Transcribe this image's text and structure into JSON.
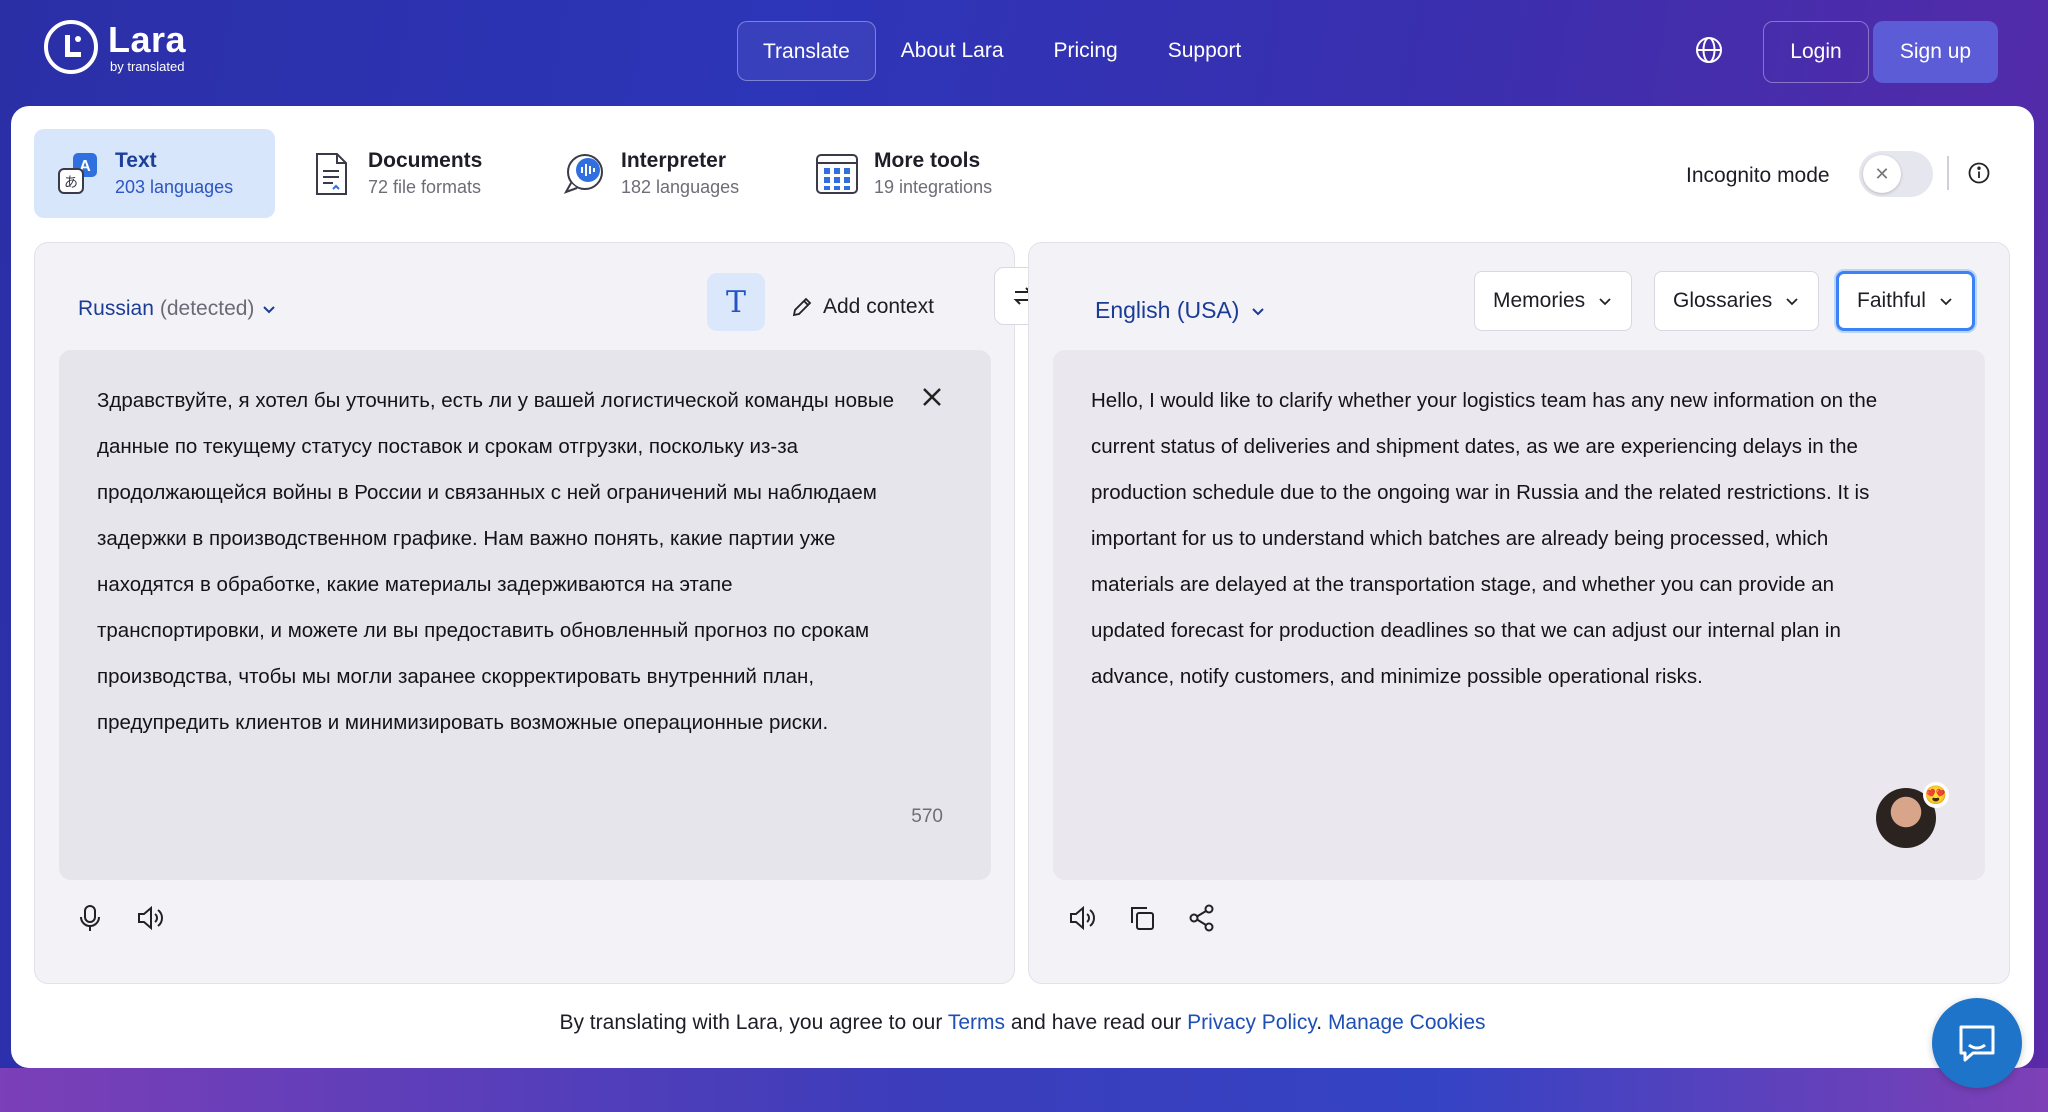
{
  "brand": {
    "name": "Lara",
    "sub": "by translated"
  },
  "nav": {
    "items": [
      {
        "label": "Translate",
        "active": true
      },
      {
        "label": "About Lara"
      },
      {
        "label": "Pricing"
      },
      {
        "label": "Support"
      }
    ],
    "login": "Login",
    "signup": "Sign up"
  },
  "tabs": [
    {
      "title": "Text",
      "sub": "203 languages",
      "icon": "text-translate-icon"
    },
    {
      "title": "Documents",
      "sub": "72 file formats",
      "icon": "document-icon"
    },
    {
      "title": "Interpreter",
      "sub": "182 languages",
      "icon": "interpreter-icon"
    },
    {
      "title": "More tools",
      "sub": "19 integrations",
      "icon": "grid-icon"
    }
  ],
  "incognito": {
    "label": "Incognito mode",
    "enabled": false
  },
  "source": {
    "language": "Russian",
    "detected": "(detected)",
    "add_context": "Add context",
    "text": "Здравствуйте, я хотел бы уточнить, есть ли у вашей логистической команды новые данные по текущему статусу поставок и срокам отгрузки, поскольку из-за продолжающейся войны в России и связанных с ней ограничений мы наблюдаем задержки в производственном графике. Нам важно понять, какие партии уже находятся в обработке, какие материалы задерживаются на этапе транспортировки, и можете ли вы предоставить обновленный прогноз по срокам производства, чтобы мы могли заранее скорректировать внутренний план, предупредить клиентов и минимизировать возможные операционные риски.",
    "char_count": "570"
  },
  "target": {
    "language": "English (USA)",
    "memories": "Memories",
    "glossaries": "Glossaries",
    "style": "Faithful",
    "text": "Hello, I would like to clarify whether your logistics team has any new information on the current status of deliveries and shipment dates, as we are experiencing delays in the production schedule due to the ongoing war in Russia and the related restrictions. It is important for us to understand which batches are already being processed, which materials are delayed at the transportation stage, and whether you can provide an updated forecast for production deadlines so that we can adjust our internal plan in advance, notify customers, and minimize possible operational risks."
  },
  "footer": {
    "prefix": "By translating with Lara, you agree to our ",
    "terms": "Terms",
    "middle": " and have read our ",
    "privacy": "Privacy Policy",
    "sep": ". ",
    "cookies": "Manage Cookies"
  },
  "colors": {
    "accent": "#1b3c96",
    "active_tab_bg": "#d7e6fb",
    "faithful_border": "#3b82f6"
  }
}
